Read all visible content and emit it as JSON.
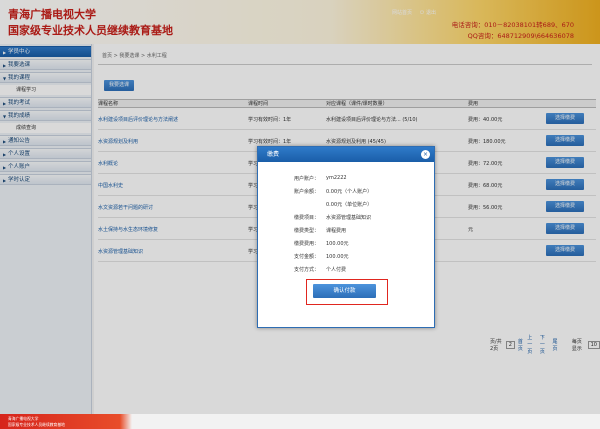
{
  "header": {
    "brand_line1": "青海广播电视大学",
    "brand_line2": "国家级专业技术人员继续教育基地",
    "top_link1": "网站首页",
    "top_link2": "退出",
    "contact_phone": "电话咨询：010－82038101转689、670",
    "contact_qq": "QQ咨询：648712909\\664636078"
  },
  "sidebar": {
    "items": [
      {
        "label": "学员中心"
      },
      {
        "label": "我要选课"
      },
      {
        "label": "我的课程"
      },
      {
        "label": "我的考试"
      },
      {
        "label": "我的成绩"
      },
      {
        "label": "通知公告"
      },
      {
        "label": "个人设置"
      },
      {
        "label": "个人账户"
      },
      {
        "label": "学时认定"
      }
    ],
    "sub_course": "课程学习",
    "sub_score": "成绩查询"
  },
  "main": {
    "breadcrumb": "首页 > 我要选课 > 水利工程",
    "tab_label": "我要选课",
    "table": {
      "headers": [
        "课程名称",
        "课程时间",
        "对应课程（课件/课时数量）",
        "费用"
      ],
      "rows": [
        {
          "name": "水利建设项目后评价理论与方法阐述",
          "time": "学习有效时间：1年",
          "course": "水利建设项目后评价理论与方法... (5/10)",
          "fee": "费用：40.00元",
          "btn": "选择缴费"
        },
        {
          "name": "水资源规划及利用",
          "time": "学习有效时间：1年",
          "course": "水资源规划及利用 (45/45)",
          "fee": "费用：180.00元",
          "btn": "选择缴费"
        },
        {
          "name": "水利概论",
          "time": "学习",
          "course": "",
          "fee": "费用：72.00元",
          "btn": "选择缴费"
        },
        {
          "name": "中国水利史",
          "time": "学习",
          "course": "",
          "fee": "费用：68.00元",
          "btn": "选择缴费"
        },
        {
          "name": "水文资源若干问题的研讨",
          "time": "学习",
          "course": "",
          "fee": "费用：56.00元",
          "btn": "选择缴费"
        },
        {
          "name": "水土保持与水生态环境修复",
          "time": "学习",
          "course": "",
          "fee": "元",
          "btn": "选择缴费"
        },
        {
          "name": "水资源管理基础知识",
          "time": "学习",
          "course": "",
          "fee": "",
          "btn": "选择缴费"
        }
      ]
    },
    "pager": {
      "text1": "页/共2页",
      "page": "2",
      "first": "首页",
      "prev": "上一页",
      "next": "下一页",
      "last": "尾页",
      "per_page": "每页显示",
      "count": "10"
    }
  },
  "modal": {
    "title": "缴费",
    "close": "×",
    "rows": [
      {
        "k": "用户账户：",
        "v": "ym2222"
      },
      {
        "k": "账户余额：",
        "v": "0.00元（个人账户）"
      },
      {
        "k": "",
        "v": "0.00元（单位账户）"
      },
      {
        "k": "缴费项目：",
        "v": "水资源管理基础知识"
      },
      {
        "k": "缴费类型：",
        "v": "课程费用"
      },
      {
        "k": "缴费费用：",
        "v": "100.00元"
      },
      {
        "k": "支付金额：",
        "v": "100.00元"
      },
      {
        "k": "支付方式：",
        "v": "个人付费"
      }
    ],
    "confirm": "确认付款"
  },
  "footer": {
    "line1": "青海广播电视大学",
    "line2": "国家级专业技术人员继续教育基地"
  }
}
